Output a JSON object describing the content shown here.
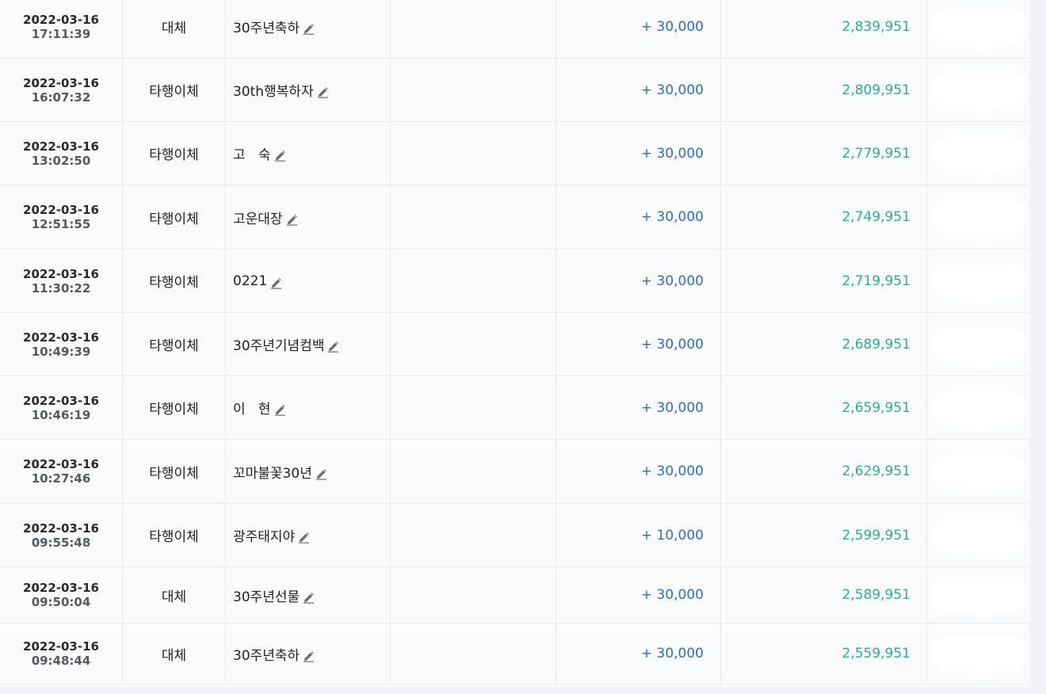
{
  "transactions": [
    {
      "date": "2022-03-16",
      "time": "17:11:39",
      "type": "대체",
      "memo": "30주년축하",
      "amount": "+ 30,000",
      "balance": "2,839,951"
    },
    {
      "date": "2022-03-16",
      "time": "16:07:32",
      "type": "타행이체",
      "memo": "30th행복하자",
      "amount": "+ 30,000",
      "balance": "2,809,951"
    },
    {
      "date": "2022-03-16",
      "time": "13:02:50",
      "type": "타행이체",
      "memo": "고   숙",
      "amount": "+ 30,000",
      "balance": "2,779,951"
    },
    {
      "date": "2022-03-16",
      "time": "12:51:55",
      "type": "타행이체",
      "memo": "고운대장",
      "amount": "+ 30,000",
      "balance": "2,749,951"
    },
    {
      "date": "2022-03-16",
      "time": "11:30:22",
      "type": "타행이체",
      "memo": "0221",
      "amount": "+ 30,000",
      "balance": "2,719,951"
    },
    {
      "date": "2022-03-16",
      "time": "10:49:39",
      "type": "타행이체",
      "memo": "30주년기념컴백",
      "amount": "+ 30,000",
      "balance": "2,689,951"
    },
    {
      "date": "2022-03-16",
      "time": "10:46:19",
      "type": "타행이체",
      "memo": "이   현",
      "amount": "+ 30,000",
      "balance": "2,659,951"
    },
    {
      "date": "2022-03-16",
      "time": "10:27:46",
      "type": "타행이체",
      "memo": "꼬마불꽃30년",
      "amount": "+ 30,000",
      "balance": "2,629,951"
    },
    {
      "date": "2022-03-16",
      "time": "09:55:48",
      "type": "타행이체",
      "memo": "광주태지야",
      "amount": "+ 10,000",
      "balance": "2,599,951"
    },
    {
      "date": "2022-03-16",
      "time": "09:50:04",
      "type": "대체",
      "memo": "30주년선물",
      "amount": "+ 30,000",
      "balance": "2,589,951"
    },
    {
      "date": "2022-03-16",
      "time": "09:48:44",
      "type": "대체",
      "memo": "30주년축하",
      "amount": "+ 30,000",
      "balance": "2,559,951"
    }
  ],
  "colors": {
    "amount": "#2e6fc1",
    "balance": "#2fae8f",
    "row_bg": "#fafbfd",
    "border": "#e9eaee"
  },
  "icons": {
    "memo_edit": "pencil-icon"
  }
}
